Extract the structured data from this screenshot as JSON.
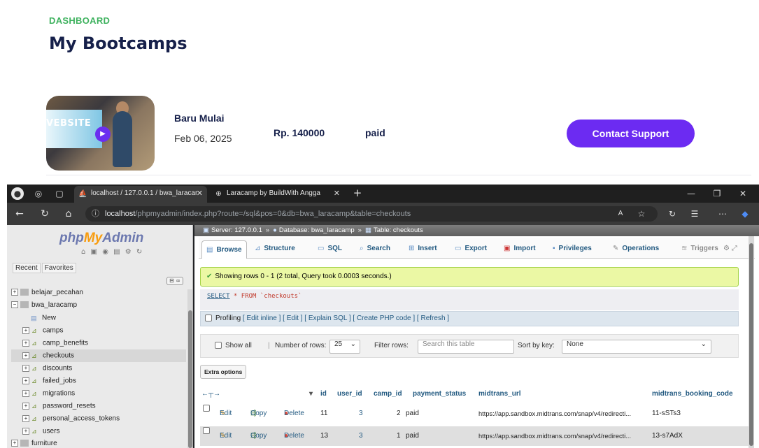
{
  "dashboard": {
    "section_label": "DASHBOARD",
    "title": "My Bootcamps",
    "thumbnail_text": "VEBSITE",
    "item": {
      "status_title": "Baru Mulai",
      "date": "Feb 06, 2025",
      "price": "Rp. 140000",
      "payment": "paid",
      "button_label": "Contact Support"
    },
    "colors": {
      "accent": "#6c2bf2",
      "label_green": "#3fb25f",
      "title_navy": "#16204a"
    }
  },
  "browser": {
    "tabs": [
      {
        "label": "localhost / 127.0.0.1 / bwa_laracar",
        "active": true,
        "icon": "phpmyadmin-icon"
      },
      {
        "label": "Laracamp by BuildWith Angga",
        "active": false,
        "icon": "globe-icon"
      }
    ],
    "url_host": "localhost",
    "url_path": "/phpmyadmin/index.php?route=/sql&pos=0&db=bwa_laracamp&table=checkouts"
  },
  "pma": {
    "logo_php": "php",
    "logo_my": "My",
    "logo_admin": "Admin",
    "nav_tabs": [
      "Recent",
      "Favorites"
    ],
    "tree": [
      {
        "label": "belajar_pecahan",
        "level": 0,
        "sign": "+"
      },
      {
        "label": "bwa_laracamp",
        "level": 0,
        "sign": "-"
      },
      {
        "label": "New",
        "level": 1,
        "sign": ""
      },
      {
        "label": "camps",
        "level": 1,
        "sign": "+"
      },
      {
        "label": "camp_benefits",
        "level": 1,
        "sign": "+"
      },
      {
        "label": "checkouts",
        "level": 1,
        "sign": "+",
        "selected": true
      },
      {
        "label": "discounts",
        "level": 1,
        "sign": "+"
      },
      {
        "label": "failed_jobs",
        "level": 1,
        "sign": "+"
      },
      {
        "label": "migrations",
        "level": 1,
        "sign": "+"
      },
      {
        "label": "password_resets",
        "level": 1,
        "sign": "+"
      },
      {
        "label": "personal_access_tokens",
        "level": 1,
        "sign": "+"
      },
      {
        "label": "users",
        "level": 1,
        "sign": "+"
      },
      {
        "label": "furniture",
        "level": 0,
        "sign": "+"
      }
    ],
    "breadcrumb": {
      "server": "Server: 127.0.0.1",
      "database": "Database: bwa_laracamp",
      "table": "Table: checkouts"
    },
    "tabs": [
      "Browse",
      "Structure",
      "SQL",
      "Search",
      "Insert",
      "Export",
      "Import",
      "Privileges",
      "Operations",
      "Triggers"
    ],
    "success_msg": "Showing rows 0 - 1 (2 total, Query took 0.0003 seconds.)",
    "sql": {
      "select": "SELECT",
      "rest": " * FROM ",
      "table": "`checkouts`"
    },
    "profiling": {
      "label": "Profiling",
      "links": "[ Edit inline ] [ Edit ] [ Explain SQL ] [ Create PHP code ] [ Refresh ]"
    },
    "controls": {
      "show_all": "Show all",
      "num_rows_label": "Number of rows:",
      "num_rows_value": "25",
      "filter_label": "Filter rows:",
      "filter_placeholder": "Search this table",
      "sort_label": "Sort by key:",
      "sort_value": "None"
    },
    "extra_options": "Extra options",
    "columns": [
      "id",
      "user_id",
      "camp_id",
      "payment_status",
      "midtrans_url",
      "midtrans_booking_code"
    ],
    "row_actions": [
      "Edit",
      "Copy",
      "Delete"
    ],
    "rows": [
      {
        "id": "11",
        "user_id": "3",
        "camp_id": "2",
        "payment_status": "paid",
        "midtrans_url": "https://app.sandbox.midtrans.com/snap/v4/redirecti...",
        "booking": "11-sSTs3"
      },
      {
        "id": "13",
        "user_id": "3",
        "camp_id": "1",
        "payment_status": "paid",
        "midtrans_url": "https://app.sandbox.midtrans.com/snap/v4/redirecti...",
        "booking": "13-s7AdX"
      }
    ]
  }
}
